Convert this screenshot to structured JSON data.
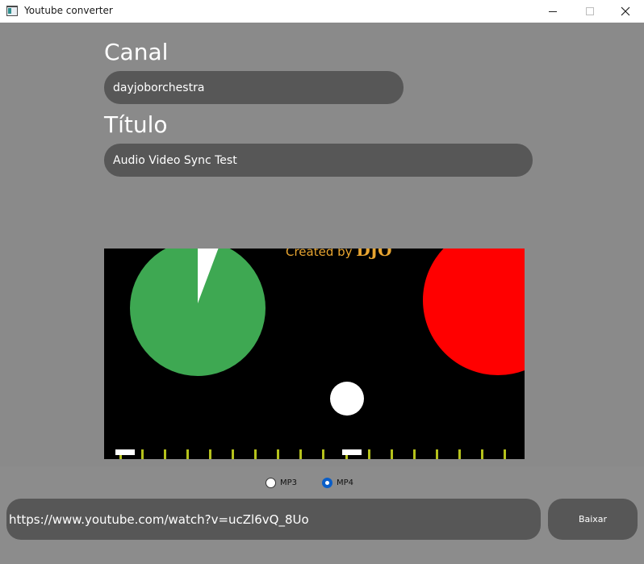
{
  "window": {
    "title": "Youtube converter",
    "controls": [
      "minimize-icon",
      "maximize-icon",
      "close-icon"
    ]
  },
  "form": {
    "channel_label": "Canal",
    "channel_value": "dayjoborchestra",
    "title_label": "Título",
    "title_value": "Audio Video Sync Test"
  },
  "thumbnail": {
    "caption": "Created by ",
    "caption_logo": "DJO",
    "caption_color": "#e8a531",
    "colors": {
      "green_circle": "#3ea852",
      "red_circle": "#ff0000",
      "tick_marks": "#b5c21b",
      "background": "#000000"
    }
  },
  "format": {
    "options": [
      {
        "label": "MP3",
        "selected": false
      },
      {
        "label": "MP4",
        "selected": true
      }
    ]
  },
  "url": {
    "value": "https://www.youtube.com/watch?v=ucZl6vQ_8Uo"
  },
  "download": {
    "label": "Baixar"
  },
  "colors": {
    "background": "#8a8a8a",
    "field": "#575757",
    "accent": "#0a5ec8"
  }
}
